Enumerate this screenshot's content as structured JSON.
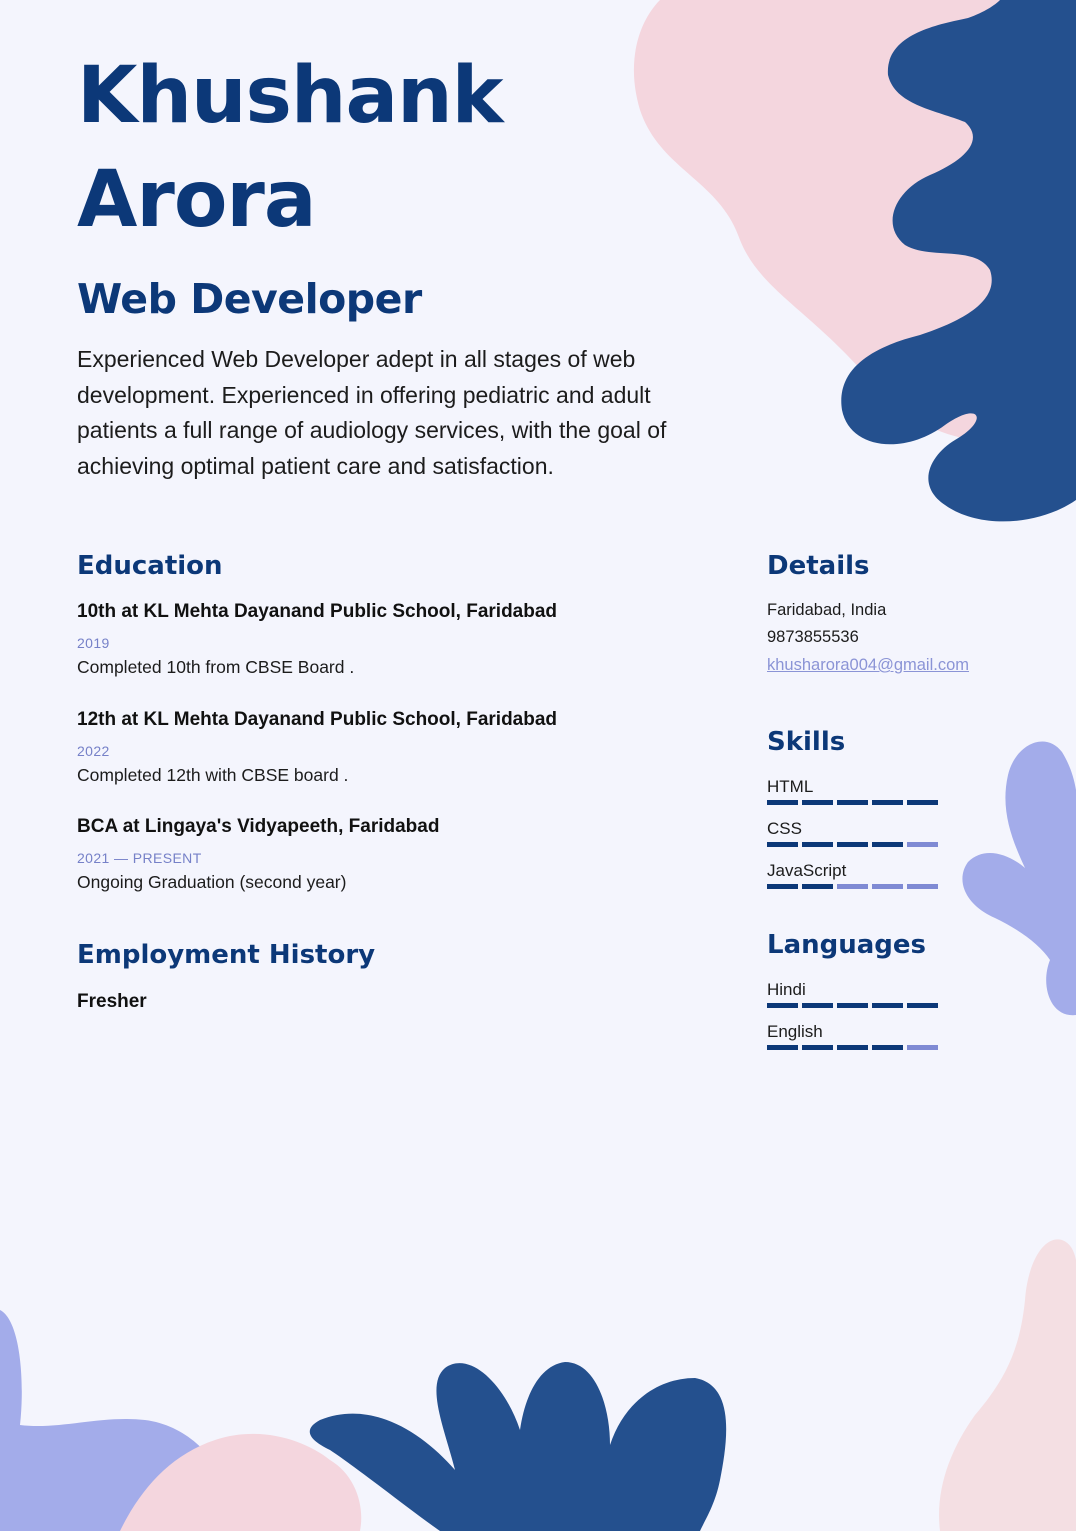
{
  "name": {
    "first": "Khushank",
    "last": "Arora"
  },
  "job_title": "Web Developer",
  "summary": [
    "Experienced Web Developer adept in all stages of web",
    "development. Experienced in offering pediatric and adult",
    "patients a full range of audiology services, with the goal of",
    "achieving optimal patient care and satisfaction."
  ],
  "education": {
    "heading": "Education",
    "items": [
      {
        "title": "10th at KL Mehta Dayanand Public School, Faridabad",
        "date": "2019",
        "description": "Completed 10th from CBSE Board ."
      },
      {
        "title": "12th at KL Mehta Dayanand Public School, Faridabad",
        "date": "2022",
        "description": "Completed 12th with CBSE board ."
      },
      {
        "title": "BCA at Lingaya's Vidyapeeth, Faridabad",
        "date": "2021 — PRESENT",
        "description": "Ongoing Graduation (second year)"
      }
    ]
  },
  "employment": {
    "heading": "Employment History",
    "text": "Fresher"
  },
  "details": {
    "heading": "Details",
    "location": "Faridabad, India",
    "phone": "9873855536",
    "email": "khusharora004@gmail.com"
  },
  "skills": {
    "heading": "Skills",
    "items": [
      {
        "label": "HTML",
        "level": 5,
        "max": 5
      },
      {
        "label": "CSS",
        "level": 4,
        "max": 5
      },
      {
        "label": "JavaScript",
        "level": 2,
        "max": 5
      }
    ]
  },
  "languages": {
    "heading": "Languages",
    "items": [
      {
        "label": "Hindi",
        "level": 5,
        "max": 5
      },
      {
        "label": "English",
        "level": 4,
        "max": 5
      }
    ]
  },
  "colors": {
    "primary": "#0c3878",
    "light_accent": "#7f8ad4",
    "background": "#f4f5fd",
    "blob_pink": "#f4d6de",
    "blob_navy": "#24508e",
    "blob_lavender": "#a3acea"
  }
}
